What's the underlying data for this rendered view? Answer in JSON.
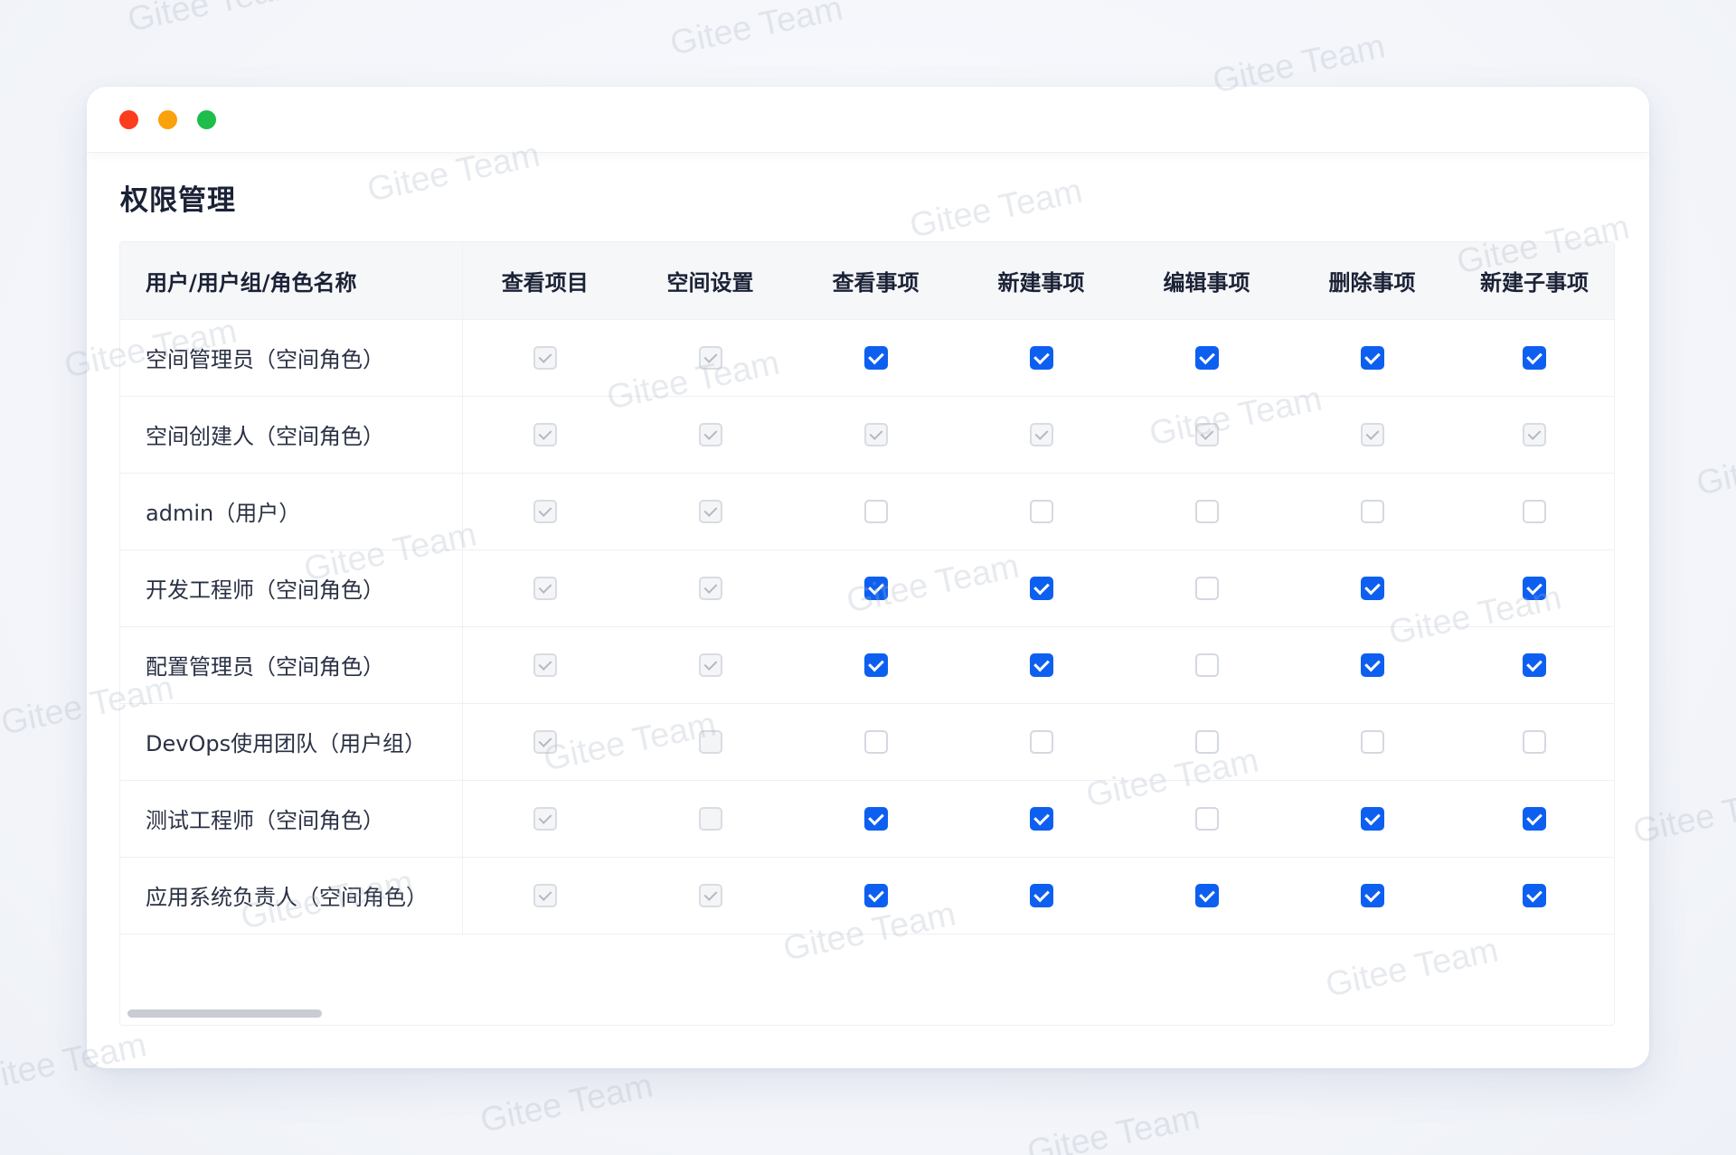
{
  "window": {
    "controls": [
      "close",
      "minimize",
      "maximize"
    ]
  },
  "page": {
    "title": "权限管理"
  },
  "table": {
    "headers": {
      "name": "用户/用户组/角色名称",
      "permissions": [
        "查看项目",
        "空间设置",
        "查看事项",
        "新建事项",
        "编辑事项",
        "删除事项",
        "新建子事项"
      ]
    },
    "rows": [
      {
        "name": "空间管理员（空间角色）",
        "states": [
          "disabled-checked",
          "disabled-checked",
          "checked",
          "checked",
          "checked",
          "checked",
          "checked"
        ]
      },
      {
        "name": "空间创建人（空间角色）",
        "states": [
          "disabled-checked",
          "disabled-checked",
          "disabled-checked",
          "disabled-checked",
          "disabled-checked",
          "disabled-checked",
          "disabled-checked"
        ]
      },
      {
        "name": "admin（用户）",
        "states": [
          "disabled-checked",
          "disabled-checked",
          "unchecked",
          "unchecked",
          "unchecked",
          "unchecked",
          "unchecked"
        ]
      },
      {
        "name": "开发工程师（空间角色）",
        "states": [
          "disabled-checked",
          "disabled-checked",
          "checked",
          "checked",
          "unchecked",
          "checked",
          "checked"
        ]
      },
      {
        "name": "配置管理员（空间角色）",
        "states": [
          "disabled-checked",
          "disabled-checked",
          "checked",
          "checked",
          "unchecked",
          "checked",
          "checked"
        ]
      },
      {
        "name": "DevOps使用团队（用户组）",
        "states": [
          "disabled-checked",
          "disabled-unchecked",
          "unchecked",
          "unchecked",
          "unchecked",
          "unchecked",
          "unchecked"
        ]
      },
      {
        "name": "测试工程师（空间角色）",
        "states": [
          "disabled-checked",
          "disabled-unchecked",
          "checked",
          "checked",
          "unchecked",
          "checked",
          "checked"
        ]
      },
      {
        "name": "应用系统负责人（空间角色）",
        "states": [
          "disabled-checked",
          "disabled-checked",
          "checked",
          "checked",
          "checked",
          "checked",
          "checked"
        ]
      }
    ]
  },
  "watermark": {
    "text": "Gitee Team"
  },
  "colors": {
    "accent": "#0d5ff0",
    "close": "#fb3d1d",
    "minimize": "#f9a20d",
    "maximize": "#1fbd4c"
  }
}
